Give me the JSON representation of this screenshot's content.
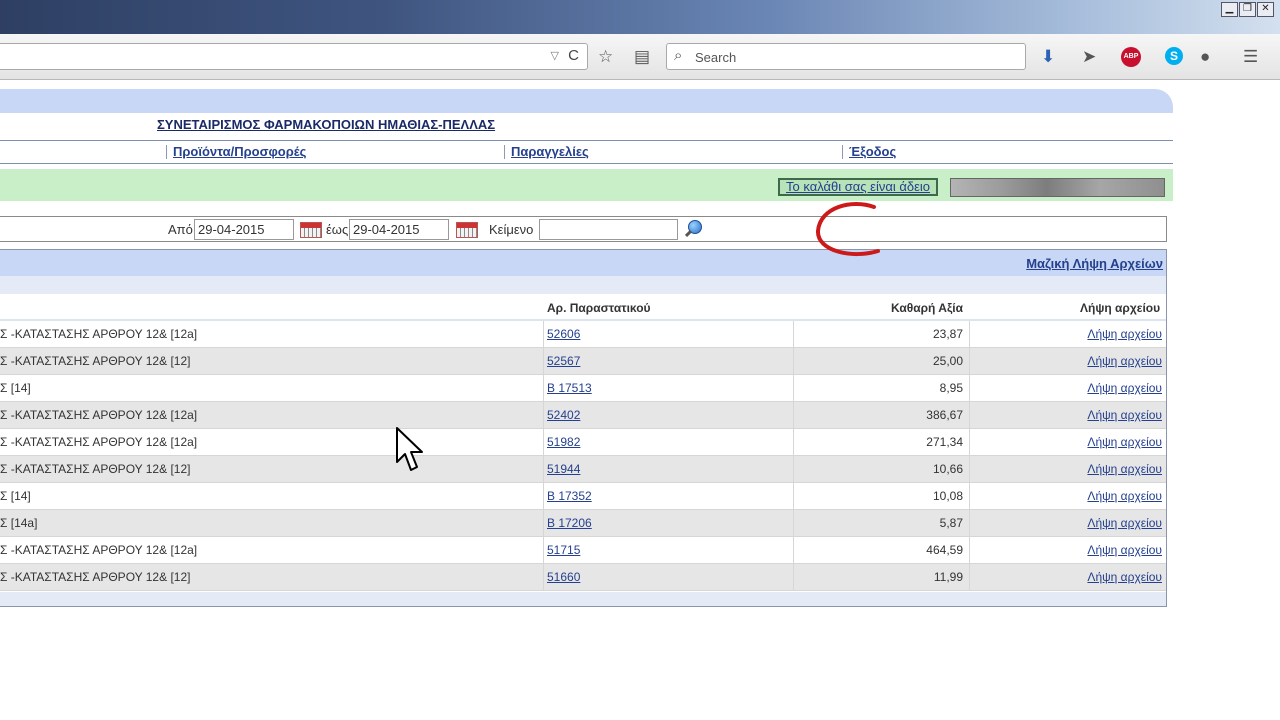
{
  "window_controls": {
    "minimize": "▁",
    "restore": "❐",
    "close": "✕"
  },
  "browser": {
    "url_dropdown": "▽",
    "reload": "C",
    "search_icon": "⌕",
    "search_placeholder": "Search",
    "abp_label": "ABP",
    "skype_label": "S",
    "icons": [
      "star-icon",
      "reader-icon",
      "download-icon",
      "send-icon",
      "adblock-icon",
      "skype-icon",
      "chat-icon",
      "menu-icon"
    ]
  },
  "header": {
    "org_title": "ΣΥΝΕΤΑΙΡΙΣΜΟΣ ΦΑΡΜΑΚΟΠΟΙΩΝ ΗΜΑΘΙΑΣ-ΠΕΛΛΑΣ",
    "menu": [
      {
        "label": "Προϊόντα/Προσφορές"
      },
      {
        "label": "Παραγγελίες"
      },
      {
        "label": "Έξοδος"
      }
    ],
    "cart_label": "Το καλάθι σας είναι άδειο"
  },
  "filters": {
    "from_label": "Από",
    "from_value": "29-04-2015",
    "to_label": "έως",
    "to_value": "29-04-2015",
    "text_label": "Κείμενο",
    "text_value": ""
  },
  "table": {
    "mass_download": "Μαζική Λήψη Αρχείων",
    "headers": {
      "doc": "Αρ. Παραστατικού",
      "value": "Καθαρή Αξία",
      "download": "Λήψη αρχείου"
    },
    "rows": [
      {
        "desc": "Σ -ΚΑΤΑΣΤΑΣΗΣ ΑΡΘΡΟΥ 12& [12a]",
        "doc": "52606",
        "value": "23,87",
        "download": "Λήψη αρχείου"
      },
      {
        "desc": "Σ -ΚΑΤΑΣΤΑΣΗΣ ΑΡΘΡΟΥ 12& [12]",
        "doc": "52567",
        "value": "25,00",
        "download": "Λήψη αρχείου"
      },
      {
        "desc": "Σ [14]",
        "doc": "Β 17513",
        "value": "8,95",
        "download": "Λήψη αρχείου"
      },
      {
        "desc": "Σ -ΚΑΤΑΣΤΑΣΗΣ ΑΡΘΡΟΥ 12& [12a]",
        "doc": "52402",
        "value": "386,67",
        "download": "Λήψη αρχείου"
      },
      {
        "desc": "Σ -ΚΑΤΑΣΤΑΣΗΣ ΑΡΘΡΟΥ 12& [12a]",
        "doc": "51982",
        "value": "271,34",
        "download": "Λήψη αρχείου"
      },
      {
        "desc": "Σ -ΚΑΤΑΣΤΑΣΗΣ ΑΡΘΡΟΥ 12& [12]",
        "doc": "51944",
        "value": "10,66",
        "download": "Λήψη αρχείου"
      },
      {
        "desc": "Σ [14]",
        "doc": "Β 17352",
        "value": "10,08",
        "download": "Λήψη αρχείου"
      },
      {
        "desc": "Σ [14a]",
        "doc": "Β 17206",
        "value": "5,87",
        "download": "Λήψη αρχείου"
      },
      {
        "desc": "Σ -ΚΑΤΑΣΤΑΣΗΣ ΑΡΘΡΟΥ 12& [12a]",
        "doc": "51715",
        "value": "464,59",
        "download": "Λήψη αρχείου"
      },
      {
        "desc": "Σ -ΚΑΤΑΣΤΑΣΗΣ ΑΡΘΡΟΥ 12& [12]",
        "doc": "51660",
        "value": "11,99",
        "download": "Λήψη αρχείου"
      }
    ]
  },
  "colors": {
    "accent": "#24408e",
    "header_band": "#c8d7f5",
    "green_bar": "#c9efc8",
    "scribble": "#cc1a1a"
  }
}
